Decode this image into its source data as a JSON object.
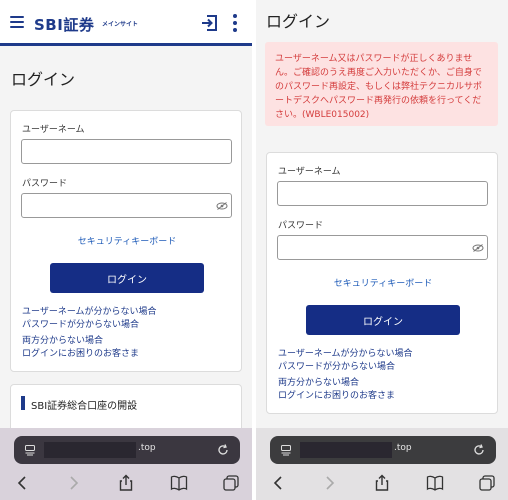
{
  "header": {
    "logo": "SBI証券",
    "logo_sub": "メインサイト"
  },
  "login": {
    "title": "ログイン",
    "username_label": "ユーザーネーム",
    "username_value": "",
    "password_label": "パスワード",
    "password_value": "",
    "security_keyboard_link": "セキュリティキーボード",
    "login_button": "ログイン",
    "help_links": [
      "ユーザーネームが分からない場合",
      "パスワードが分からない場合",
      "両方分からない場合",
      "ログインにお困りのお客さま"
    ]
  },
  "account_section": {
    "title": "SBI証券総合口座の開設"
  },
  "error": {
    "message": "ユーザーネーム又はパスワードが正しくありません。ご確認のうえ再度ご入力いただくか、ご自身でのパスワード再設定、もしくは弊社テクニカルサポートデスクへパスワード再発行の依頼を行ってください。(WBLE015002)"
  },
  "browser": {
    "url_suffix": ".top"
  },
  "colors": {
    "brand": "#1e3a8a",
    "button": "#152d85",
    "link": "#1e5bb8",
    "error_text": "#d43c3c",
    "error_bg": "#fde2e2"
  },
  "icons": [
    "hamburger-icon",
    "login-door-icon",
    "more-vertical-icon",
    "eye-off-icon",
    "tabs-icon",
    "reload-icon",
    "back-icon",
    "forward-icon",
    "share-icon",
    "bookmarks-icon",
    "tab-switcher-icon"
  ]
}
